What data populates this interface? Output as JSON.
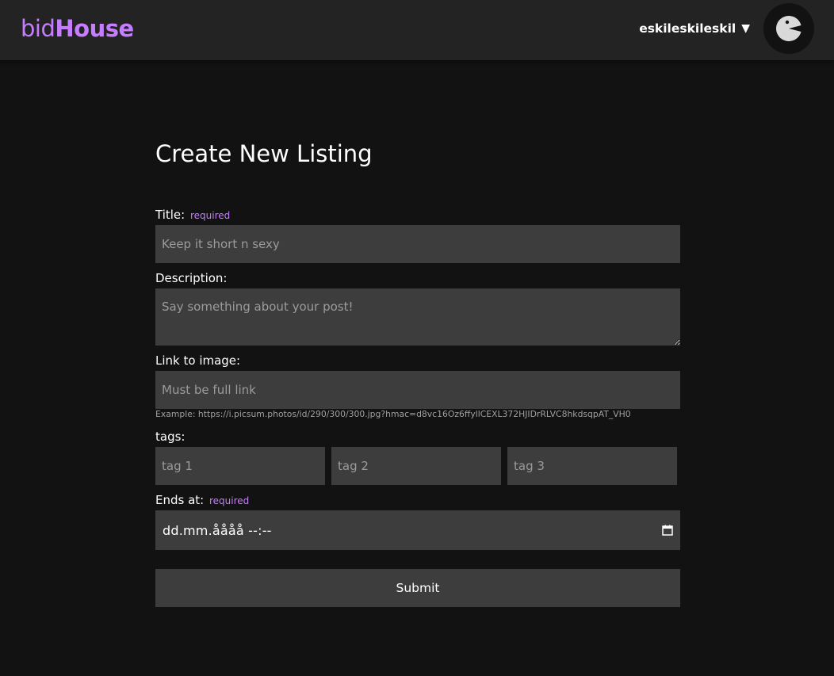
{
  "navbar": {
    "brand_light": "bid",
    "brand_bold": "House",
    "username": "eskileskileskil",
    "caret": "▼",
    "avatar_icon": "pacman-avatar-icon",
    "accent_color": "#c77dff"
  },
  "form": {
    "title": "Create New Listing",
    "title_label": "Title:",
    "required_text": "required",
    "title_placeholder": "Keep it short n sexy",
    "description_label": "Description:",
    "description_placeholder": "Say something about your post!",
    "image_label": "Link to image:",
    "image_placeholder": "Must be full link",
    "image_hint": "Example: https://i.picsum.photos/id/290/300/300.jpg?hmac=d8vc16Oz6ffyllCEXL372HJIDrRLVC8hkdsqpAT_VH0",
    "tags_label": "tags:",
    "tag_placeholders": [
      "tag 1",
      "tag 2",
      "tag 3"
    ],
    "ends_label": "Ends at:",
    "ends_value": "dd.mm.åååå --:--",
    "calendar_icon": "calendar-icon",
    "submit_label": "Submit"
  }
}
